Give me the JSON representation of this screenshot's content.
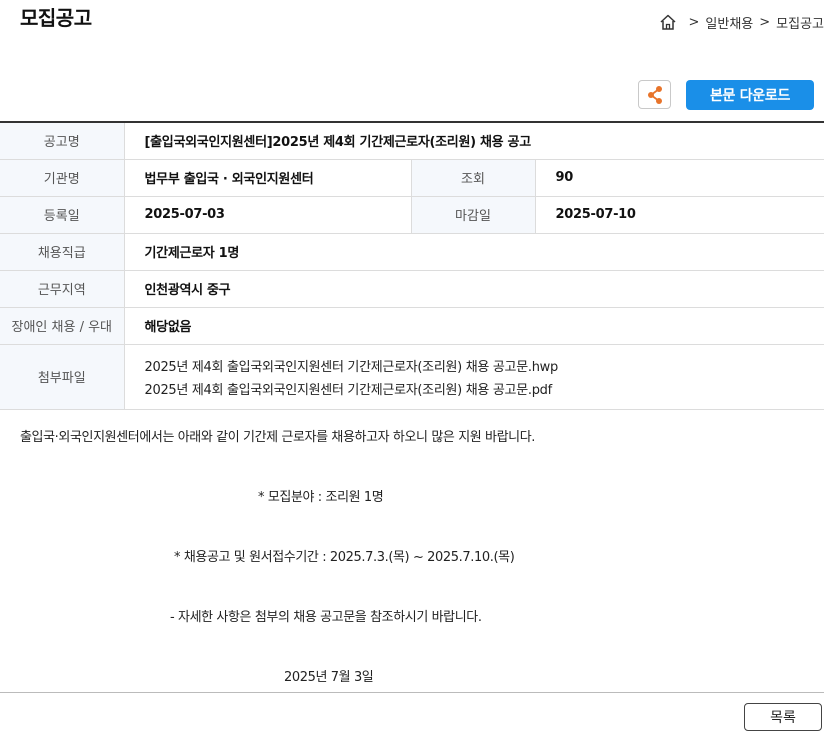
{
  "header": {
    "title": "모집공고",
    "breadcrumb": [
      "일반채용",
      "모집공고"
    ],
    "separator": ">"
  },
  "actions": {
    "download_label": "본문 다운로드",
    "list_label": "목록"
  },
  "colors": {
    "accent": "#1a8fe8",
    "share_icon": "#e8742a",
    "header_cell_bg": "#f5f8fc"
  },
  "details": {
    "title_label": "공고명",
    "title_value": "[출입국외국인지원센터]2025년 제4회 기간제근로자(조리원) 채용 공고",
    "org_label": "기관명",
    "org_value": "법무부 출입국 · 외국인지원센터",
    "views_label": "조회",
    "views_value": "90",
    "reg_label": "등록일",
    "reg_value": "2025-07-03",
    "deadline_label": "마감일",
    "deadline_value": "2025-07-10",
    "position_label": "채용직급",
    "position_value": "기간제근로자 1명",
    "region_label": "근무지역",
    "region_value": "인천광역시 중구",
    "disability_label": "장애인 채용 / 우대",
    "disability_value": "해당없음",
    "files_label": "첨부파일",
    "files": [
      "2025년 제4회 출입국외국인지원센터 기간제근로자(조리원) 채용 공고문.hwp",
      "2025년 제4회 출입국외국인지원센터 기간제근로자(조리원) 채용 공고문.pdf"
    ]
  },
  "body": {
    "intro": "출입국·외국인지원센터에서는 아래와 같이 기간제 근로자를 채용하고자 하오니 많은 지원 바랍니다.",
    "field": "* 모집분야 : 조리원 1명",
    "period": "* 채용공고 및 원서접수기간 : 2025.7.3.(목) ~ 2025.7.10.(목)",
    "note": "- 자세한 사항은 첨부의 채용 공고문을 참조하시기 바랍니다.",
    "date": "2025년 7월 3일"
  },
  "icons": {
    "home": "home-icon",
    "share": "share-icon"
  }
}
